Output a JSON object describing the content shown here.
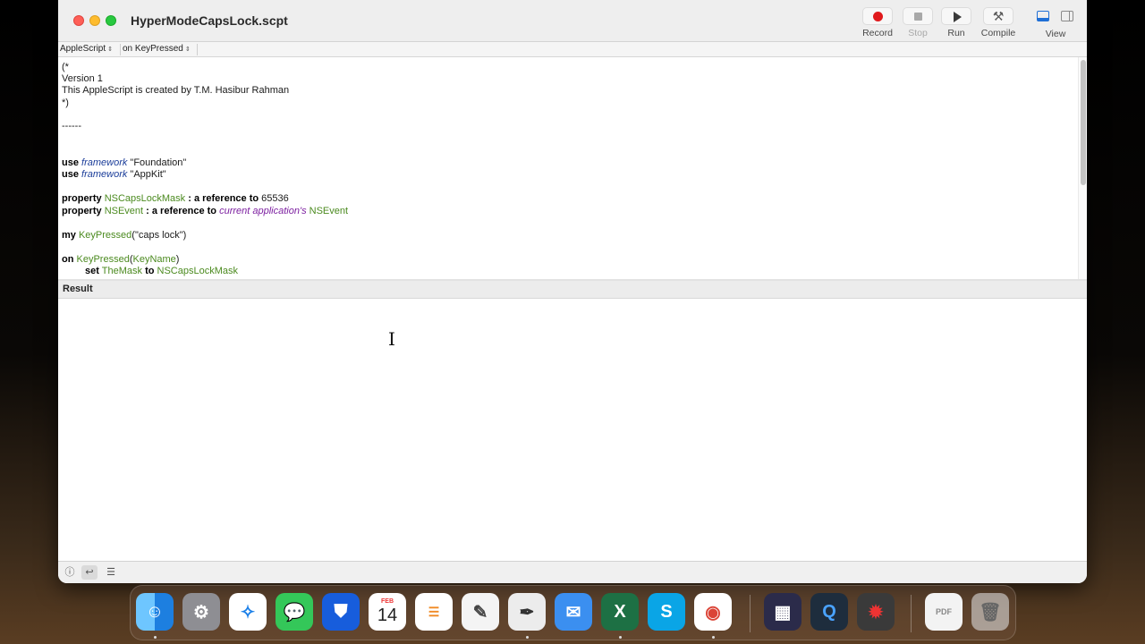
{
  "window": {
    "title": "HyperModeCapsLock.scpt"
  },
  "toolbar": {
    "record": "Record",
    "stop": "Stop",
    "run": "Run",
    "compile": "Compile",
    "view": "View"
  },
  "navbar": {
    "language": "AppleScript",
    "handler": "on KeyPressed"
  },
  "code": {
    "l1": "(*",
    "l2": "Version 1",
    "l3": "This AppleScript is created by T.M. Hasibur Rahman",
    "l4": "*)",
    "l5": "------",
    "use1_kw": "use",
    "use1_fw": "framework",
    "use1_str": " \"Foundation\"",
    "use2_kw": "use",
    "use2_fw": "framework",
    "use2_str": " \"AppKit\"",
    "prop1_kw": "property",
    "prop1_name": "NSCapsLockMask",
    "prop1_ref": " : a reference to ",
    "prop1_val": "65536",
    "prop2_kw": "property",
    "prop2_name": "NSEvent",
    "prop2_ref": " : a reference to ",
    "prop2_app": "current application's",
    "prop2_cls": "NSEvent",
    "my_kw": "my",
    "my_handler": "KeyPressed",
    "my_arg": "(\"caps lock\")",
    "on_kw": "on",
    "on_handler": "KeyPressed",
    "on_param": "KeyName",
    "set_kw": "set",
    "set_var": "TheMask",
    "set_to": "to",
    "set_val": "NSCapsLockMask"
  },
  "result": {
    "header": "Result"
  },
  "dock": {
    "calendar_month": "FEB",
    "calendar_day": "14",
    "apps": [
      "Finder",
      "System Settings",
      "Safari",
      "Messages",
      "Bitwarden",
      "Calendar",
      "Reminders",
      "TextEdit",
      "Script Editor",
      "Mail",
      "Excel",
      "Skype",
      "Chrome",
      "App",
      "QuickTime",
      "Bug App",
      "PDF",
      "Trash"
    ]
  },
  "colors": {
    "keyword": "#000000",
    "framework": "#1c3e9a",
    "variable": "#4b8a1f",
    "application": "#7c1fa0",
    "record_red": "#e0191c"
  }
}
